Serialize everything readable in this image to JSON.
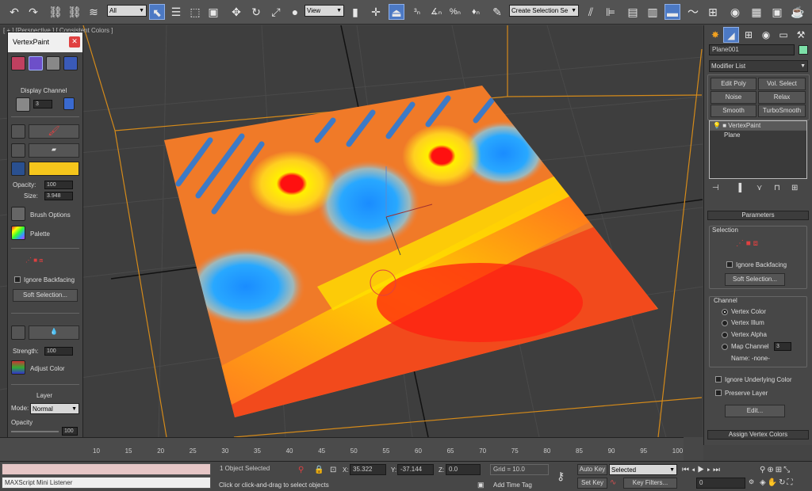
{
  "toolbar": {
    "filter": "All",
    "coord": "View",
    "selection_set": "Create Selection Se"
  },
  "viewport": {
    "label": "[ + ] [Perspective ] [ Consistent Colors ]"
  },
  "vpaint": {
    "title": "VertexPaint",
    "display_channel": "Display Channel",
    "channel_value": "3",
    "opacity_label": "Opacity:",
    "opacity": "100",
    "size_label": "Size:",
    "size": "3.948",
    "brush_options": "Brush Options",
    "palette": "Palette",
    "ignore_backfacing": "Ignore Backfacing",
    "soft_selection": "Soft Selection...",
    "strength_label": "Strength:",
    "strength": "100",
    "adjust_color": "Adjust Color",
    "layer": "Layer",
    "mode_label": "Mode:",
    "mode": "Normal",
    "opacity2_label": "Opacity",
    "opacity2": "100",
    "paint_color": "#f5c61c"
  },
  "cmd": {
    "object_name": "Plane001",
    "modifier_list": "Modifier List",
    "mod_buttons": [
      "Edit Poly",
      "Vol. Select",
      "Noise",
      "Relax",
      "Smooth",
      "TurboSmooth"
    ],
    "stack": [
      "VertexPaint",
      "Plane"
    ],
    "parameters": "Parameters",
    "selection": "Selection",
    "ignore_backfacing": "Ignore Backfacing",
    "soft_selection": "Soft Selection...",
    "channel": "Channel",
    "channels": [
      "Vertex Color",
      "Vertex Illum",
      "Vertex Alpha",
      "Map Channel"
    ],
    "map_channel_value": "3",
    "name_label": "Name:  -none-",
    "ignore_underlying": "Ignore Underlying Color",
    "preserve_layer": "Preserve Layer",
    "edit": "Edit...",
    "assign": "Assign Vertex Colors",
    "object_color": "#7de0a8"
  },
  "timeline": {
    "ticks": [
      "10",
      "15",
      "20",
      "25",
      "30",
      "35",
      "40",
      "45",
      "50",
      "55",
      "60",
      "65",
      "70",
      "75",
      "80",
      "85",
      "90",
      "95",
      "100"
    ]
  },
  "status": {
    "maxscript": "MAXScript Mini Listener",
    "selected": "1 Object Selected",
    "prompt": "Click or click-and-drag to select objects",
    "x_label": "X:",
    "x": "35.322",
    "y_label": "Y:",
    "y": "-37.144",
    "z_label": "Z:",
    "z": "0.0",
    "grid": "Grid = 10.0",
    "add_time_tag": "Add Time Tag",
    "auto_key": "Auto Key",
    "auto_key_sel": "Selected",
    "set_key": "Set Key",
    "key_filters": "Key Filters...",
    "frame": "0"
  }
}
